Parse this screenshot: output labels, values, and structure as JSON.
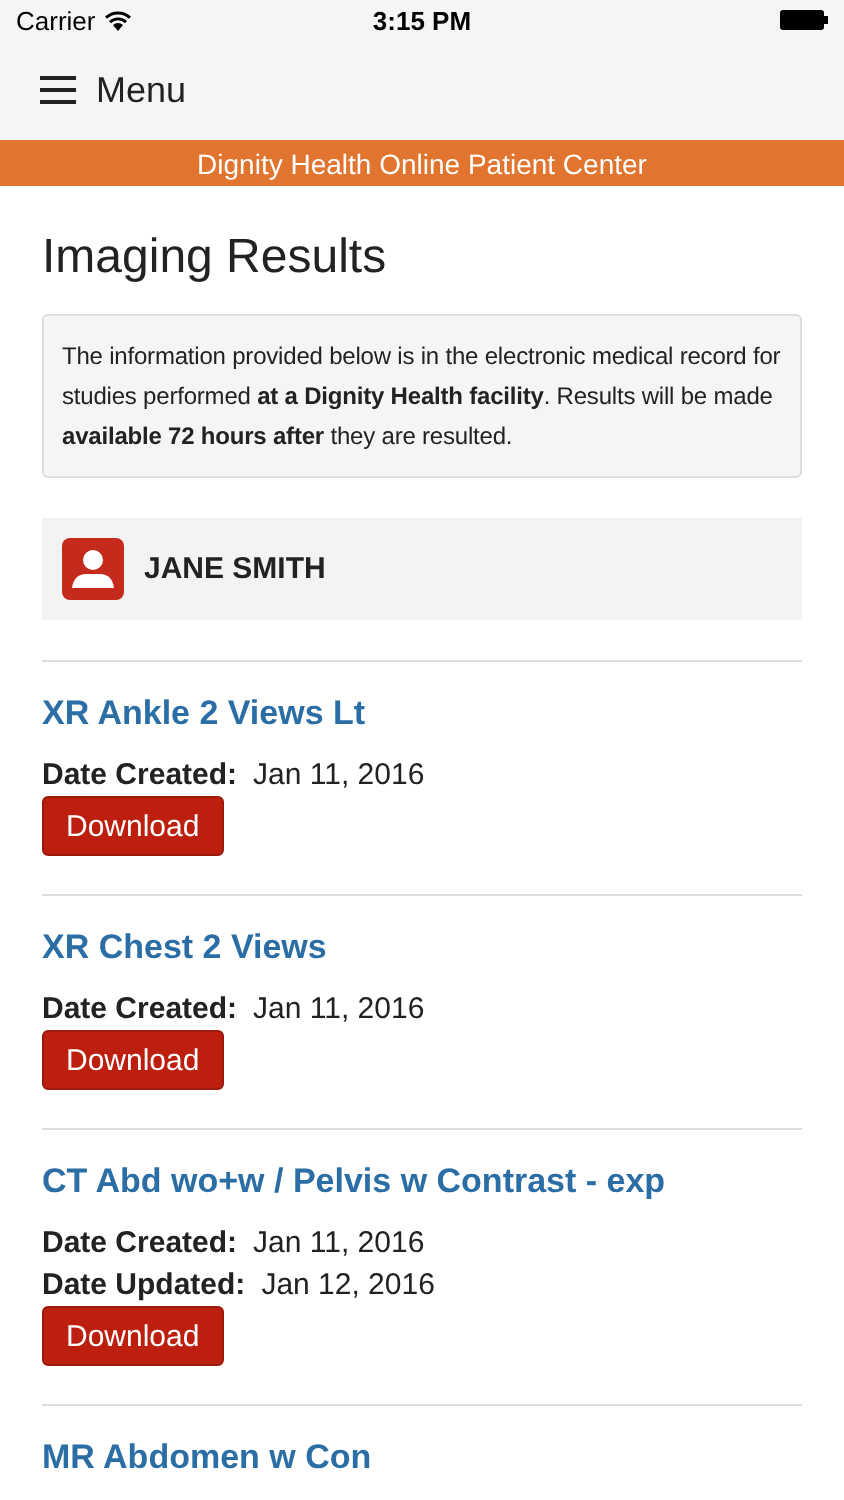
{
  "status_bar": {
    "carrier": "Carrier",
    "time": "3:15 PM"
  },
  "nav": {
    "menu_label": "Menu"
  },
  "banner": {
    "title": "Dignity Health Online Patient Center"
  },
  "page_title": "Imaging Results",
  "notice": "The information provided below is in the electronic medical record for studies performed **at a Dignity Health facility**. Results will be made **available 72 hours after** they are resulted.",
  "patient": {
    "name": "JANE SMITH"
  },
  "results": [
    {
      "title": "XR Ankle 2 Views Lt",
      "dates": [
        {
          "label": "Date Created:",
          "value": "Jan 11, 2016"
        }
      ],
      "button": "Download"
    },
    {
      "title": "XR Chest 2 Views",
      "dates": [
        {
          "label": "Date Created:",
          "value": "Jan 11, 2016"
        }
      ],
      "button": "Download"
    },
    {
      "title": "CT Abd wo+w / Pelvis w Contrast - exp",
      "dates": [
        {
          "label": "Date Created:",
          "value": "Jan 11, 2016"
        },
        {
          "label": "Date Updated:",
          "value": "Jan 12, 2016"
        }
      ],
      "button": "Download"
    },
    {
      "title": "MR Abdomen w Con"
    }
  ]
}
